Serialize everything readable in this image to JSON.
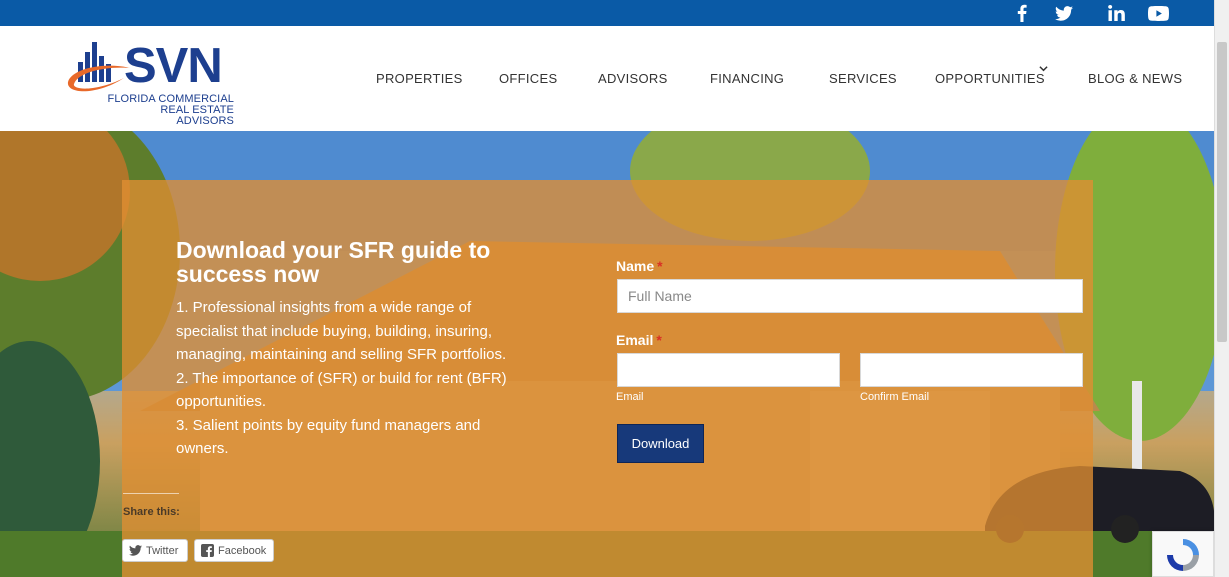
{
  "social": {
    "facebook_icon": "facebook-icon",
    "twitter_icon": "twitter-icon",
    "linkedin_icon": "linkedin-icon",
    "youtube_icon": "youtube-icon"
  },
  "logo": {
    "wordmark": "SVN",
    "line1": "FLORIDA COMMERCIAL",
    "line2": "REAL ESTATE ADVISORS"
  },
  "nav": {
    "items": [
      "PROPERTIES",
      "OFFICES",
      "ADVISORS",
      "FINANCING",
      "SERVICES",
      "OPPORTUNITIES",
      "BLOG & NEWS"
    ]
  },
  "hero": {
    "title": "Download your SFR guide to success now",
    "points": [
      "1. Professional insights from a wide range of",
      "specialist that include buying, building, insuring,",
      "managing, maintaining and selling SFR portfolios.",
      "2. The importance of (SFR) or build for rent (BFR)",
      "opportunities.",
      "3. Salient points by equity fund managers and",
      "owners."
    ]
  },
  "share": {
    "label": "Share this:",
    "twitter": "Twitter",
    "facebook": "Facebook"
  },
  "form": {
    "name_label": "Name",
    "required_mark": "*",
    "name_placeholder": "Full Name",
    "email_label": "Email",
    "email_sublabel": "Email",
    "confirm_sublabel": "Confirm Email",
    "download_label": "Download"
  },
  "colors": {
    "topbar": "#0a5aa6",
    "overlay": "#e08e32",
    "button": "#17397a",
    "brand_orange": "#e8692a",
    "brand_blue": "#1d3f8f"
  }
}
